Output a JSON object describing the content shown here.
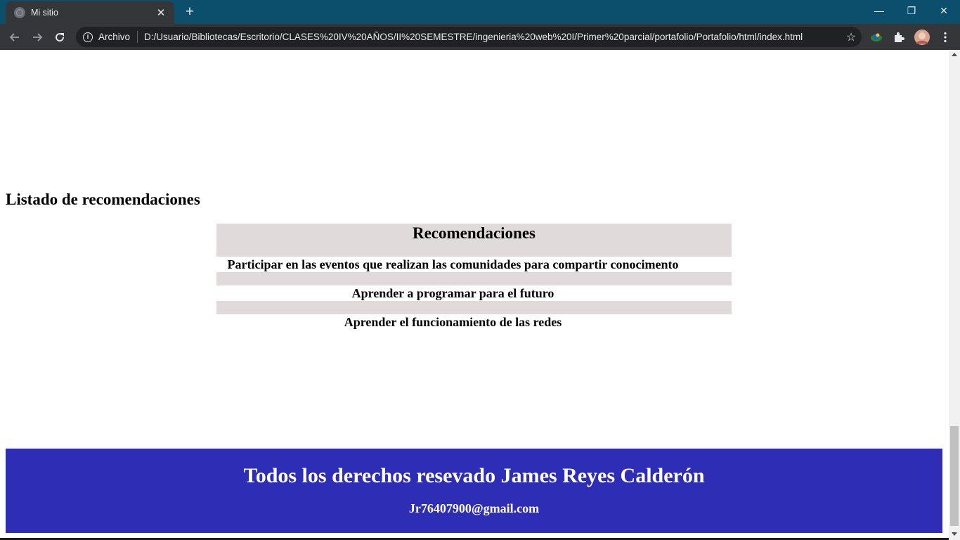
{
  "browser": {
    "tab_title": "Mi sitio",
    "close_tab": "✕",
    "new_tab": "+",
    "window_controls": {
      "minimize": "—",
      "restore": "❐",
      "close": "✕"
    },
    "address": {
      "scheme_label": "Archivo",
      "url": "D:/Usuario/Bibliotecas/Escritorio/CLASES%20IV%20AÑOS/II%20SEMESTRE/ingenieria%20web%20I/Primer%20parcial/portafolio/Portafolio/html/index.html"
    },
    "toolbar_icons": [
      "back-arrow-icon",
      "forward-arrow-icon",
      "reload-icon",
      "info-icon",
      "star-icon",
      "extension-icon",
      "puzzle-icon",
      "profile-avatar",
      "menu-dots-icon"
    ],
    "frame_color": "#0b4f6c"
  },
  "page": {
    "section_title": "Listado de recomendaciones",
    "table": {
      "header": "Recomendaciones",
      "rows": [
        "Participar en las eventos que realizan las comunidades para compartir conocimento",
        "Aprender a programar para el futuro",
        "Aprender el funcionamiento de las redes"
      ],
      "row_band_color": "#e0dada"
    },
    "footer": {
      "copyright": "Todos los derechos resevado James Reyes Calderón",
      "email": "Jr76407900@gmail.com",
      "background": "#2e2db5"
    }
  }
}
